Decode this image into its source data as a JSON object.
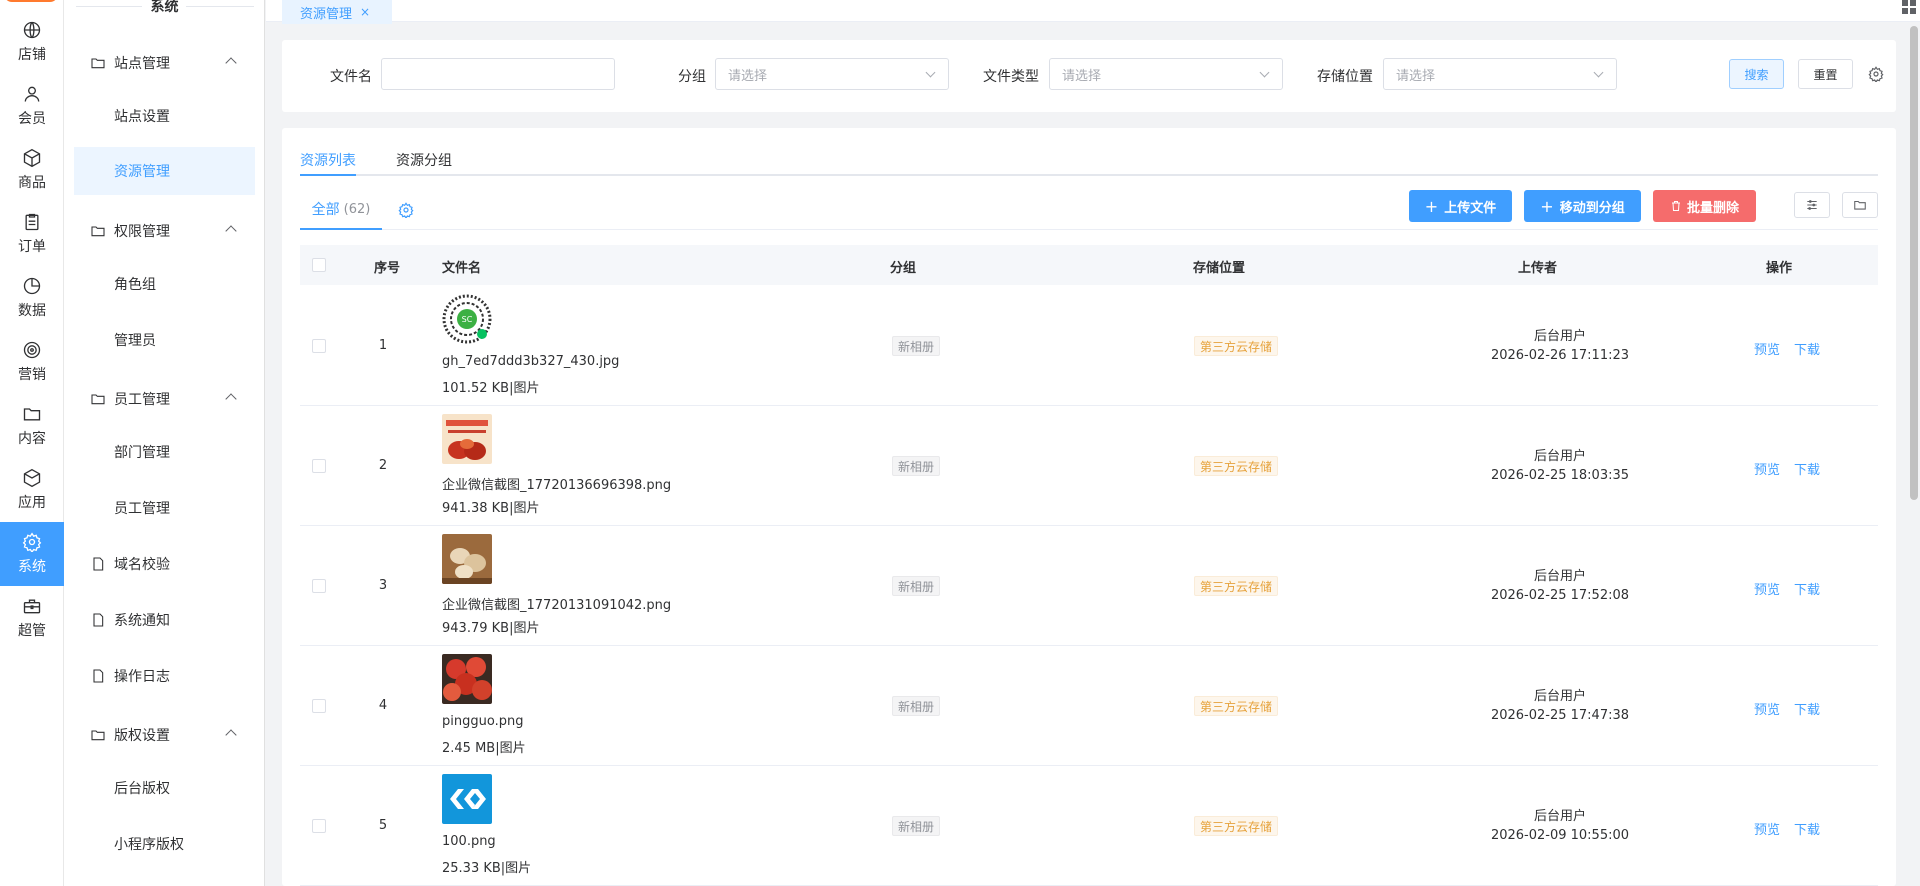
{
  "rail": {
    "items": [
      {
        "label": "店铺",
        "icon": "globe-icon"
      },
      {
        "label": "会员",
        "icon": "user-icon"
      },
      {
        "label": "商品",
        "icon": "cube-icon"
      },
      {
        "label": "订单",
        "icon": "clipboard-icon"
      },
      {
        "label": "数据",
        "icon": "pie-chart-icon"
      },
      {
        "label": "营销",
        "icon": "target-icon"
      },
      {
        "label": "内容",
        "icon": "folder-icon"
      },
      {
        "label": "应用",
        "icon": "box-icon"
      },
      {
        "label": "系统",
        "icon": "gear-icon"
      },
      {
        "label": "超管",
        "icon": "toolbox-icon"
      }
    ],
    "active_index": 8,
    "accent": "#409eff"
  },
  "menu": {
    "title": "系统",
    "items": [
      {
        "label": "站点管理",
        "type": "group"
      },
      {
        "label": "站点设置",
        "type": "sub"
      },
      {
        "label": "资源管理",
        "type": "sub",
        "active": true
      },
      {
        "label": "权限管理",
        "type": "group"
      },
      {
        "label": "角色组",
        "type": "sub"
      },
      {
        "label": "管理员",
        "type": "sub"
      },
      {
        "label": "员工管理",
        "type": "group"
      },
      {
        "label": "部门管理",
        "type": "sub"
      },
      {
        "label": "员工管理",
        "type": "sub"
      },
      {
        "label": "域名校验",
        "type": "page"
      },
      {
        "label": "系统通知",
        "type": "page"
      },
      {
        "label": "操作日志",
        "type": "page"
      },
      {
        "label": "版权设置",
        "type": "group"
      },
      {
        "label": "后台版权",
        "type": "sub"
      },
      {
        "label": "小程序版权",
        "type": "sub"
      }
    ]
  },
  "tabbar": {
    "tab_label": "资源管理",
    "close": "×"
  },
  "search": {
    "filename_label": "文件名",
    "filename_value": "",
    "group_label": "分组",
    "group_placeholder": "请选择",
    "type_label": "文件类型",
    "type_placeholder": "请选择",
    "storage_label": "存储位置",
    "storage_placeholder": "请选择",
    "search_btn": "搜索",
    "reset_btn": "重置"
  },
  "main": {
    "tabs": [
      "资源列表",
      "资源分组"
    ],
    "all_tab": "全部",
    "all_count": "(62)",
    "upload_btn": "上传文件",
    "move_btn": "移动到分组",
    "delete_btn": "批量删除",
    "columns": [
      "序号",
      "文件名",
      "分组",
      "存储位置",
      "上传者",
      "操作"
    ]
  },
  "rows": [
    {
      "idx": "1",
      "name": "gh_7ed7ddd3b327_430.jpg",
      "size": "101.52 KB|图片",
      "group": "新相册",
      "storage": "第三方云存储",
      "uploader": "后台用户",
      "time": "2026-02-26 17:11:23",
      "preview": "预览",
      "download": "下载",
      "thumb": "qr-code-thumbnail"
    },
    {
      "idx": "2",
      "name": "企业微信截图_17720136696398.png",
      "size": "941.38 KB|图片",
      "group": "新相册",
      "storage": "第三方云存储",
      "uploader": "后台用户",
      "time": "2026-02-25 18:03:35",
      "preview": "预览",
      "download": "下载",
      "thumb": "food-poster-thumbnail"
    },
    {
      "idx": "3",
      "name": "企业微信截图_17720131091042.png",
      "size": "943.79 KB|图片",
      "group": "新相册",
      "storage": "第三方云存储",
      "uploader": "后台用户",
      "time": "2026-02-25 17:52:08",
      "preview": "预览",
      "download": "下载",
      "thumb": "mushroom-thumbnail"
    },
    {
      "idx": "4",
      "name": "pingguo.png",
      "size": "2.45 MB|图片",
      "group": "新相册",
      "storage": "第三方云存储",
      "uploader": "后台用户",
      "time": "2026-02-25 17:47:38",
      "preview": "预览",
      "download": "下载",
      "thumb": "apples-thumbnail"
    },
    {
      "idx": "5",
      "name": "100.png",
      "size": "25.33 KB|图片",
      "group": "新相册",
      "storage": "第三方云存储",
      "uploader": "后台用户",
      "time": "2026-02-09 10:55:00",
      "preview": "预览",
      "download": "下载",
      "thumb": "blue-logo-thumbnail"
    }
  ]
}
